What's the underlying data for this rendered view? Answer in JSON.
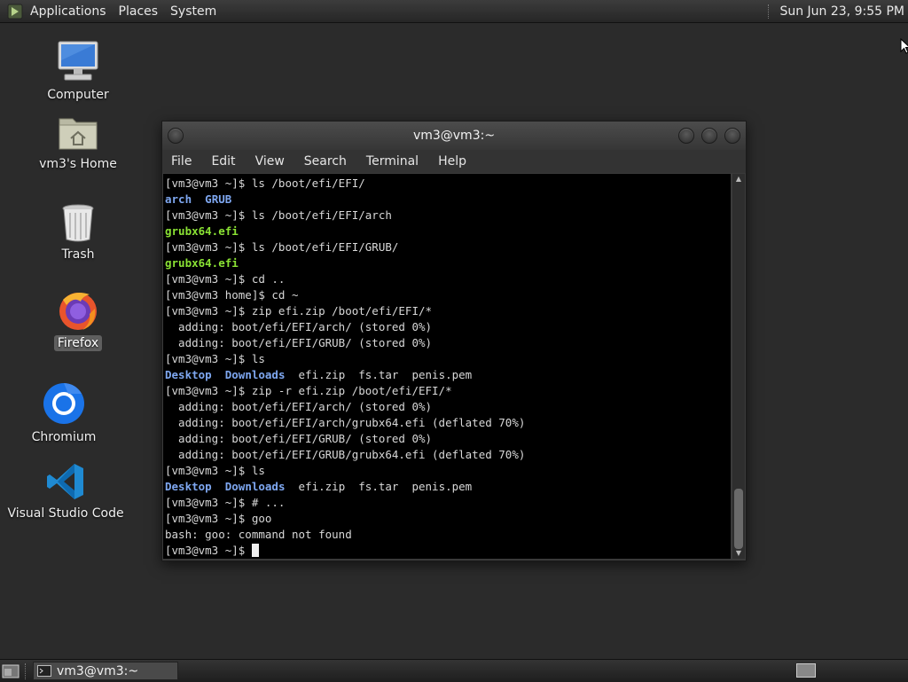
{
  "top_panel": {
    "menus": [
      "Applications",
      "Places",
      "System"
    ],
    "clock": "Sun Jun 23,  9:55 PM"
  },
  "desktop": {
    "icons": [
      {
        "label": "Computer",
        "icon": "computer-icon"
      },
      {
        "label": "vm3's Home",
        "icon": "home-folder-icon"
      },
      {
        "label": "Trash",
        "icon": "trash-icon"
      },
      {
        "label": "Firefox",
        "icon": "firefox-icon",
        "selected": true
      },
      {
        "label": "Chromium",
        "icon": "chromium-icon"
      },
      {
        "label": "Visual Studio Code",
        "icon": "vscode-icon"
      }
    ]
  },
  "window": {
    "title": "vm3@vm3:~",
    "menu": [
      "File",
      "Edit",
      "View",
      "Search",
      "Terminal",
      "Help"
    ]
  },
  "terminal": {
    "lines": [
      [
        {
          "t": "[vm3@vm3 ~]$ ls /boot/efi/EFI/"
        }
      ],
      [
        {
          "t": "arch",
          "c": "dir"
        },
        {
          "t": "  "
        },
        {
          "t": "GRUB",
          "c": "dir"
        }
      ],
      [
        {
          "t": "[vm3@vm3 ~]$ ls /boot/efi/EFI/arch"
        }
      ],
      [
        {
          "t": "grubx64.efi",
          "c": "exe"
        }
      ],
      [
        {
          "t": "[vm3@vm3 ~]$ ls /boot/efi/EFI/GRUB/"
        }
      ],
      [
        {
          "t": "grubx64.efi",
          "c": "exe"
        }
      ],
      [
        {
          "t": "[vm3@vm3 ~]$ cd .."
        }
      ],
      [
        {
          "t": "[vm3@vm3 home]$ cd ~"
        }
      ],
      [
        {
          "t": "[vm3@vm3 ~]$ zip efi.zip /boot/efi/EFI/*"
        }
      ],
      [
        {
          "t": "  adding: boot/efi/EFI/arch/ (stored 0%)"
        }
      ],
      [
        {
          "t": "  adding: boot/efi/EFI/GRUB/ (stored 0%)"
        }
      ],
      [
        {
          "t": "[vm3@vm3 ~]$ ls"
        }
      ],
      [
        {
          "t": "Desktop",
          "c": "dir"
        },
        {
          "t": "  "
        },
        {
          "t": "Downloads",
          "c": "dir"
        },
        {
          "t": "  efi.zip  fs.tar  penis.pem"
        }
      ],
      [
        {
          "t": "[vm3@vm3 ~]$ zip -r efi.zip /boot/efi/EFI/*"
        }
      ],
      [
        {
          "t": "  adding: boot/efi/EFI/arch/ (stored 0%)"
        }
      ],
      [
        {
          "t": "  adding: boot/efi/EFI/arch/grubx64.efi (deflated 70%)"
        }
      ],
      [
        {
          "t": "  adding: boot/efi/EFI/GRUB/ (stored 0%)"
        }
      ],
      [
        {
          "t": "  adding: boot/efi/EFI/GRUB/grubx64.efi (deflated 70%)"
        }
      ],
      [
        {
          "t": "[vm3@vm3 ~]$ ls"
        }
      ],
      [
        {
          "t": "Desktop",
          "c": "dir"
        },
        {
          "t": "  "
        },
        {
          "t": "Downloads",
          "c": "dir"
        },
        {
          "t": "  efi.zip  fs.tar  penis.pem"
        }
      ],
      [
        {
          "t": "[vm3@vm3 ~]$ # ..."
        }
      ],
      [
        {
          "t": "[vm3@vm3 ~]$ goo"
        }
      ],
      [
        {
          "t": "bash: goo: command not found"
        }
      ],
      [
        {
          "t": "[vm3@vm3 ~]$ "
        },
        {
          "cursor": true
        }
      ]
    ]
  },
  "taskbar": {
    "task_label": "vm3@vm3:~"
  },
  "colors": {
    "dir": "#7ea7f0",
    "exe": "#8ae234",
    "desktop_bg": "#2b2b2b"
  }
}
